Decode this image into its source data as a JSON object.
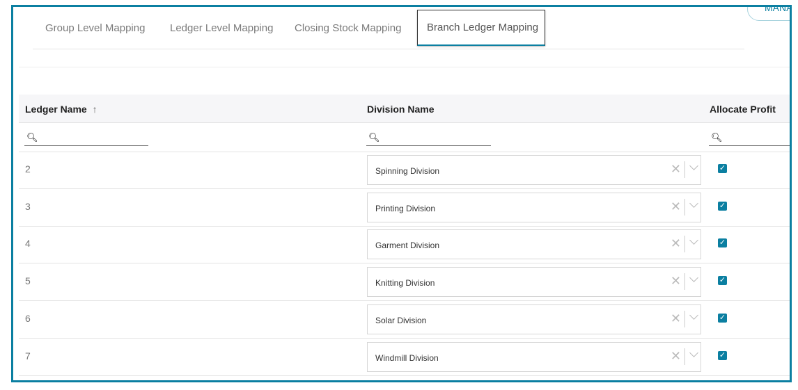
{
  "header": {
    "manage_label": "MANAGE"
  },
  "tabs": [
    {
      "label": "Group Level Mapping"
    },
    {
      "label": "Ledger Level Mapping"
    },
    {
      "label": "Closing Stock Mapping"
    },
    {
      "label": "Branch Ledger Mapping",
      "active": true
    }
  ],
  "table": {
    "columns": [
      {
        "label": "Ledger Name",
        "sort": "ascending"
      },
      {
        "label": "Division Name"
      },
      {
        "label": "Allocate Profit"
      }
    ],
    "sort_icon": "↑",
    "rows": [
      {
        "ledger": "2",
        "division": "Spinning Division",
        "allocate": true
      },
      {
        "ledger": "3",
        "division": "Printing Division",
        "allocate": true
      },
      {
        "ledger": "4",
        "division": "Garment Division",
        "allocate": true
      },
      {
        "ledger": "5",
        "division": "Knitting Division",
        "allocate": true
      },
      {
        "ledger": "6",
        "division": "Solar Division",
        "allocate": true
      },
      {
        "ledger": "7",
        "division": "Windmill Division",
        "allocate": true
      }
    ]
  },
  "colors": {
    "accent": "#0b7fa1"
  }
}
